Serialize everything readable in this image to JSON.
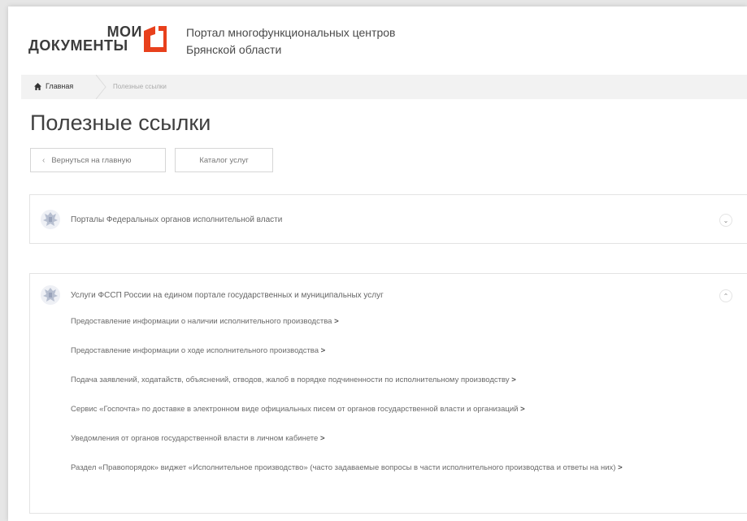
{
  "header": {
    "logo_line1": "МОИ",
    "logo_line2": "ДОКУМЕНТЫ",
    "portal_title_line1": "Портал многофункциональных центров",
    "portal_title_line2": "Брянской области",
    "logo_color": "#e8401c"
  },
  "breadcrumb": {
    "home": "Главная",
    "current": "Полезные ссылки"
  },
  "page_title": "Полезные ссылки",
  "buttons": {
    "back": "Вернуться на главную",
    "catalog": "Каталог услуг"
  },
  "accordions": [
    {
      "title": "Порталы Федеральных органов исполнительной власти",
      "expanded": false,
      "toggle_icon": "chevron-down-icon"
    },
    {
      "title": "Услуги ФССП России на едином портале государственных и муниципальных услуг",
      "expanded": true,
      "toggle_icon": "chevron-up-icon",
      "links": [
        "Предоставление информации о наличии исполнительного производства",
        "Предоставление информации о ходе исполнительного производства",
        "Подача заявлений, ходатайств, объяснений, отводов, жалоб в порядке подчиненности по исполнительному производству",
        "Сервис «Госпочта» по доставке в электронном виде официальных писем от органов государственной власти и организаций",
        "Уведомления от органов государственной власти в личном кабинете",
        "Раздел «Правопорядок» виджет «Исполнительное производство» (часто задаваемые вопросы в части исполнительного производства и ответы на них)"
      ]
    }
  ],
  "link_arrow": ">"
}
